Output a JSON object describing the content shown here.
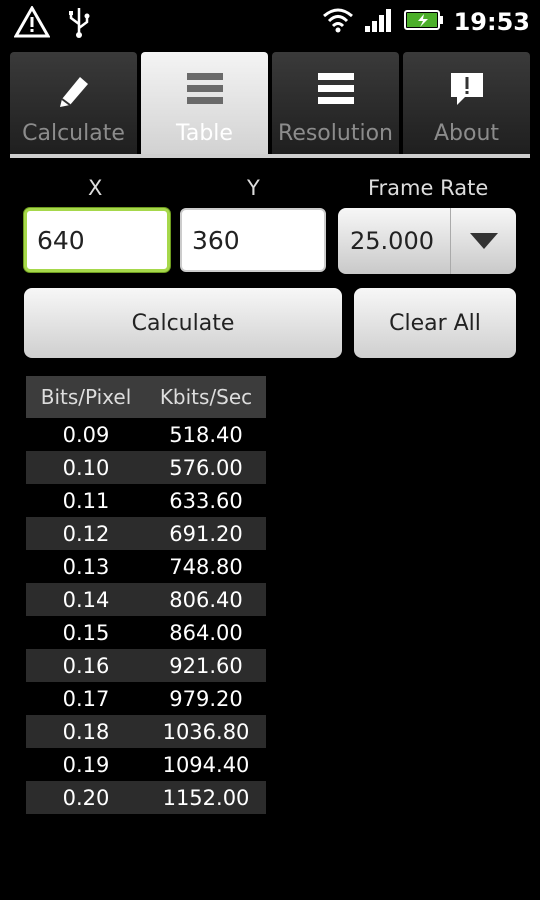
{
  "status": {
    "time": "19:53"
  },
  "tabs": [
    {
      "label": "Calculate",
      "icon": "pencil-icon",
      "active": false
    },
    {
      "label": "Table",
      "icon": "list-icon",
      "active": true
    },
    {
      "label": "Resolution",
      "icon": "list-icon",
      "active": false
    },
    {
      "label": "About",
      "icon": "speech-bubble-icon",
      "active": false
    }
  ],
  "inputs": {
    "x_label": "X",
    "y_label": "Y",
    "frame_rate_label": "Frame Rate",
    "x_value": "640",
    "y_value": "360",
    "frame_rate_value": "25.000"
  },
  "buttons": {
    "calculate": "Calculate",
    "clear_all": "Clear All"
  },
  "table": {
    "headers": [
      "Bits/Pixel",
      "Kbits/Sec"
    ],
    "rows": [
      [
        "0.09",
        "518.40"
      ],
      [
        "0.10",
        "576.00"
      ],
      [
        "0.11",
        "633.60"
      ],
      [
        "0.12",
        "691.20"
      ],
      [
        "0.13",
        "748.80"
      ],
      [
        "0.14",
        "806.40"
      ],
      [
        "0.15",
        "864.00"
      ],
      [
        "0.16",
        "921.60"
      ],
      [
        "0.17",
        "979.20"
      ],
      [
        "0.18",
        "1036.80"
      ],
      [
        "0.19",
        "1094.40"
      ],
      [
        "0.20",
        "1152.00"
      ]
    ]
  }
}
